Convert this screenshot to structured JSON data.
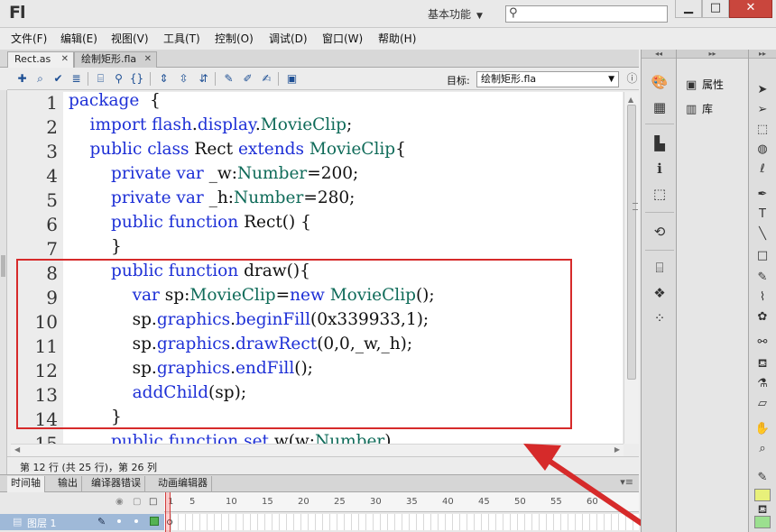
{
  "app": {
    "logo": "Fl",
    "workspace": "基本功能",
    "search_placeholder": ""
  },
  "window_controls": {
    "minimize": "▁",
    "maximize": "□",
    "close": "✕"
  },
  "menu": [
    "文件(F)",
    "编辑(E)",
    "视图(V)",
    "工具(T)",
    "控制(O)",
    "调试(D)",
    "窗口(W)",
    "帮助(H)"
  ],
  "doc_tabs": [
    {
      "label": "Rect.as",
      "close": "✕"
    },
    {
      "label": "绘制矩形.fla",
      "close": "✕"
    }
  ],
  "editor_toolbar": {
    "target_label": "目标:",
    "target_value": "绘制矩形.fla"
  },
  "code": {
    "line_numbers": [
      "1",
      "2",
      "3",
      "4",
      "5",
      "6",
      "7",
      "8",
      "9",
      "10",
      "11",
      "12",
      "13",
      "14",
      "15"
    ],
    "lines": [
      "package  {",
      "    import flash.display.MovieClip;",
      "    public class Rect extends MovieClip{",
      "        private var _w:Number=200;",
      "        private var _h:Number=280;",
      "        public function Rect() {",
      "        }",
      "        public function draw(){",
      "            var sp:MovieClip=new MovieClip();",
      "            sp.graphics.beginFill(0x339933,1);",
      "            sp.graphics.drawRect(0,0,_w,_h);",
      "            sp.graphics.endFill();",
      "            addChild(sp);",
      "        }",
      "        public function set w(w:Number)"
    ]
  },
  "status": "第 12 行 (共 25 行)，第 26 列",
  "bottom_tabs": [
    "时间轴",
    "输出",
    "编译器错误",
    "动画编辑器"
  ],
  "timeline": {
    "ruler": [
      "1",
      "5",
      "10",
      "15",
      "20",
      "25",
      "30",
      "35",
      "40",
      "45",
      "50",
      "55",
      "60"
    ],
    "layer_name": "图层 1"
  },
  "side_panel": {
    "properties_label": "属性",
    "library_label": "库"
  },
  "colors": {
    "keyword": "#1d2fd6",
    "type": "#0f6b59",
    "annotation": "#d62a2a",
    "close_button": "#c9463d"
  }
}
